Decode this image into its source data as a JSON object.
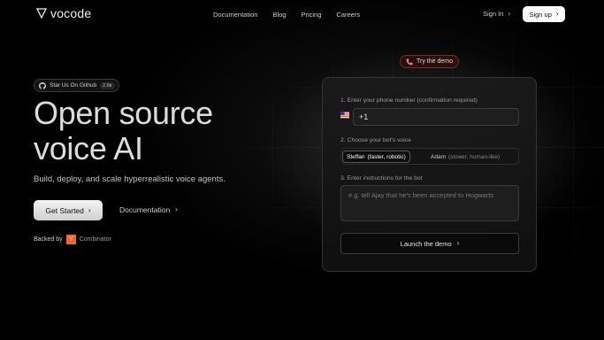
{
  "brand": {
    "name": "vocode",
    "logo_icon": "triangle-down-icon"
  },
  "nav": {
    "items": [
      "Documentation",
      "Blog",
      "Pricing",
      "Careers"
    ],
    "signin": "Sign In",
    "signup": "Sign up"
  },
  "hero": {
    "star_label": "Star Us On Github",
    "star_count": "2.6k",
    "title_line1": "Open source",
    "title_line2": "voice AI",
    "subtitle": "Build, deploy, and scale hyperrealistic voice agents.",
    "cta_primary": "Get Started",
    "cta_secondary": "Documentation",
    "backed_by": "Backed by",
    "yc_letter": "Y",
    "yc_name": "Combinator"
  },
  "demo": {
    "try_label": "Try the demo",
    "step1_label": "1. Enter your phone number (confirmation required)",
    "phone_value": "+1",
    "step2_label": "2. Choose your bot's voice",
    "voice1_name": "Steffan",
    "voice1_desc": "(faster, robotic)",
    "voice2_name": "Adam",
    "voice2_desc": "(slower, human-like)",
    "step3_label": "3. Enter instructions for the bot",
    "instructions_placeholder": "e.g. tell Ajay that he's been accepted to Hogwarts",
    "launch_label": "Launch the demo"
  },
  "colors": {
    "accent": "#f26522",
    "background": "#000000",
    "demo_pill": "#2a0d0d"
  }
}
